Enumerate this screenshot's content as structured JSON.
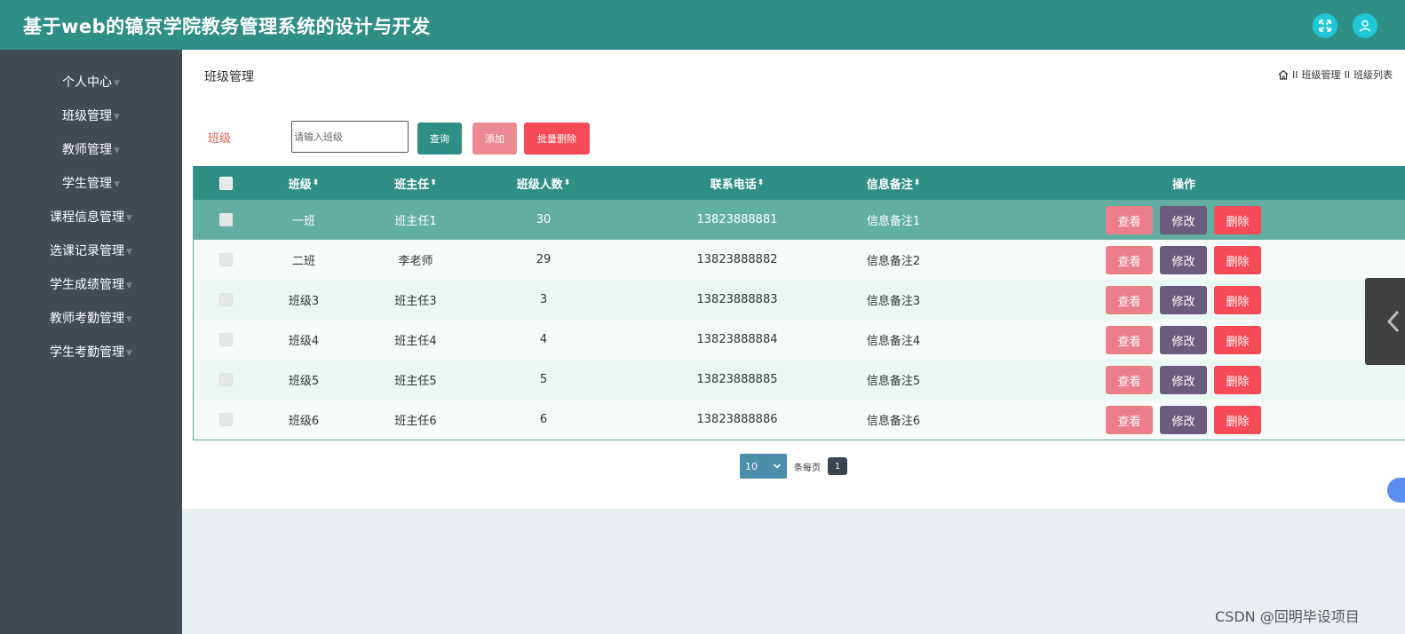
{
  "header": {
    "title": "基于web的镐京学院教务管理系统的设计与开发",
    "icons": [
      "fullscreen-icon",
      "user-icon"
    ]
  },
  "sidebar": {
    "items": [
      {
        "label": "个人中心"
      },
      {
        "label": "班级管理"
      },
      {
        "label": "教师管理"
      },
      {
        "label": "学生管理"
      },
      {
        "label": "课程信息管理"
      },
      {
        "label": "选课记录管理"
      },
      {
        "label": "学生成绩管理"
      },
      {
        "label": "教师考勤管理"
      },
      {
        "label": "学生考勤管理"
      }
    ]
  },
  "page": {
    "title": "班级管理",
    "breadcrumb": {
      "sep": "II",
      "level1": "班级管理",
      "level2": "班级列表"
    }
  },
  "search": {
    "label": "班级",
    "placeholder": "请输入班级",
    "query_label": "查询",
    "add_label": "添加",
    "bulk_delete_label": "批量删除"
  },
  "table": {
    "columns": {
      "name": "班级",
      "teacher": "班主任",
      "count": "班级人数",
      "phone": "联系电话",
      "note": "信息备注",
      "ops": "操作"
    },
    "sort_glyph": "⬍",
    "rows": [
      {
        "name": "一班",
        "teacher": "班主任1",
        "count": "30",
        "phone": "13823888881",
        "note": "信息备注1"
      },
      {
        "name": "二班",
        "teacher": "李老师",
        "count": "29",
        "phone": "13823888882",
        "note": "信息备注2"
      },
      {
        "name": "班级3",
        "teacher": "班主任3",
        "count": "3",
        "phone": "13823888883",
        "note": "信息备注3"
      },
      {
        "name": "班级4",
        "teacher": "班主任4",
        "count": "4",
        "phone": "13823888884",
        "note": "信息备注4"
      },
      {
        "name": "班级5",
        "teacher": "班主任5",
        "count": "5",
        "phone": "13823888885",
        "note": "信息备注5"
      },
      {
        "name": "班级6",
        "teacher": "班主任6",
        "count": "6",
        "phone": "13823888886",
        "note": "信息备注6"
      }
    ],
    "actions": {
      "view": "查看",
      "edit": "修改",
      "delete": "删除"
    }
  },
  "pager": {
    "page_size": "10",
    "per_page_label": "条每页",
    "current_page": "1"
  },
  "watermark": "CSDN @回明毕设项目",
  "colors": {
    "primary": "#2f8f87",
    "sidebar": "#414a55",
    "view": "#ec7e89",
    "edit": "#6b5b7d",
    "delete": "#f64a56"
  }
}
